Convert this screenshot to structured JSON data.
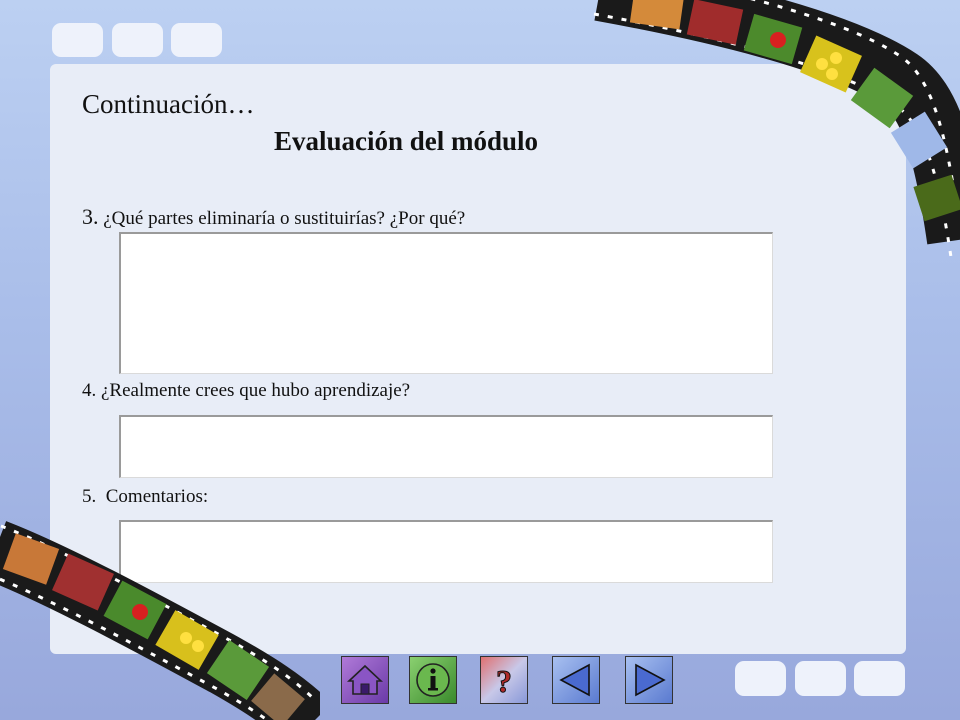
{
  "slide": {
    "title": "Continuación…",
    "subtitle": "Evaluación del módulo",
    "questions": [
      {
        "num": "3.",
        "text": " ¿Qué partes eliminaría o sustituirías? ¿Por qué?"
      },
      {
        "num": "4.",
        "text": " ¿Realmente crees que hubo aprendizaje?"
      },
      {
        "num": "5.",
        "text": "  Comentarios:"
      }
    ],
    "answers": [
      "",
      "",
      ""
    ]
  },
  "nav": {
    "buttons": [
      {
        "name": "home",
        "icon": "home-icon"
      },
      {
        "name": "info",
        "icon": "info-icon"
      },
      {
        "name": "help",
        "icon": "question-icon"
      },
      {
        "name": "previous",
        "icon": "triangle-left-icon"
      },
      {
        "name": "next",
        "icon": "triangle-right-icon"
      }
    ]
  },
  "colors": {
    "background": "#a9bde9",
    "panel": "#e8edf7",
    "film_strip": "#1a1a1a"
  }
}
